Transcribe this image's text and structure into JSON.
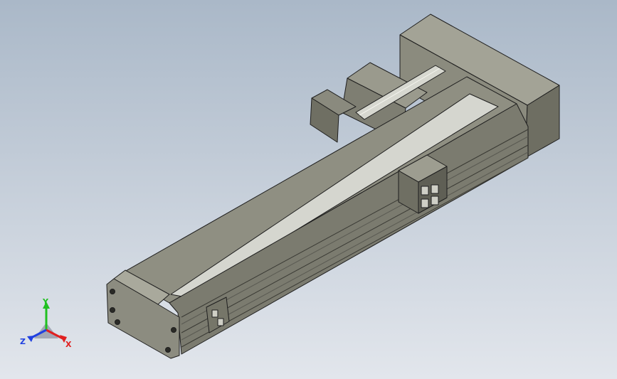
{
  "viewport": {
    "background_top": "#aab8c8",
    "background_bottom": "#e2e6ec"
  },
  "model": {
    "body_color": "#8d8d7f",
    "body_light": "#b6b6a9",
    "body_dark": "#6b6b5f",
    "edge_color": "#1e1e1e",
    "rail_color": "#cfd0c8"
  },
  "triad": {
    "x_label": "X",
    "y_label": "Y",
    "z_label": "Z",
    "x_color": "#e02020",
    "y_color": "#20c020",
    "z_color": "#2040e0"
  }
}
